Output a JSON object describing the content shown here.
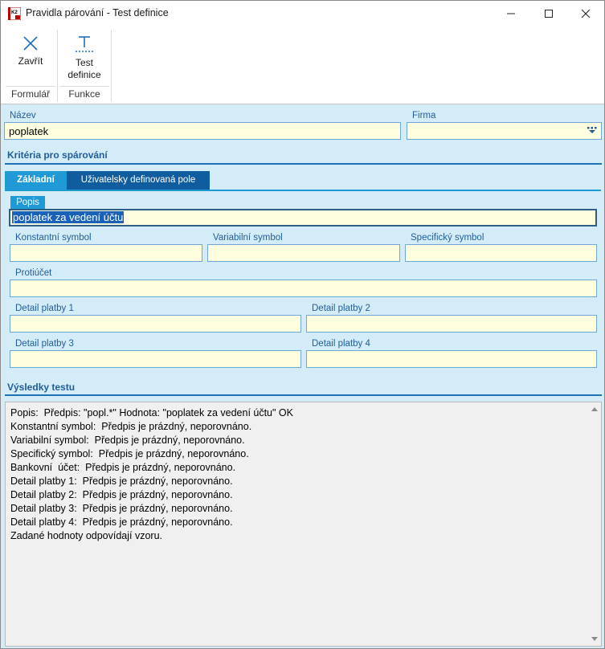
{
  "window": {
    "title": "Pravidla párování - Test definice",
    "app_icon_label": "K2"
  },
  "ribbon": {
    "close_label": "Zavřít",
    "test_label_line1": "Test",
    "test_label_line2": "definice",
    "group_formular": "Formulář",
    "group_funkce": "Funkce"
  },
  "form": {
    "nazev_label": "Název",
    "nazev_value": "poplatek",
    "firma_label": "Firma",
    "firma_value": ""
  },
  "criteria": {
    "title": "Kritéria pro spárování",
    "tabs": [
      "Základní",
      "Uživatelsky definovaná pole"
    ],
    "active_tab": 0,
    "popis_label": "Popis",
    "popis_value": "poplatek za vedení účtu",
    "konst_label": "Konstantní symbol",
    "var_label": "Variabilní symbol",
    "spec_label": "Specifický symbol",
    "protiucet_label": "Protiúčet",
    "detail1_label": "Detail platby 1",
    "detail2_label": "Detail platby 2",
    "detail3_label": "Detail platby 3",
    "detail4_label": "Detail platby 4"
  },
  "results": {
    "title": "Výsledky testu",
    "lines": [
      "Popis:  Předpis: \"popl.*\" Hodnota: \"poplatek za vedení účtu\" OK",
      "Konstantní symbol:  Předpis je prázdný, neporovnáno.",
      "Variabilní symbol:  Předpis je prázdný, neporovnáno.",
      "Specifický symbol:  Předpis je prázdný, neporovnáno.",
      "Bankovní  účet:  Předpis je prázdný, neporovnáno.",
      "Detail platby 1:  Předpis je prázdný, neporovnáno.",
      "Detail platby 2:  Předpis je prázdný, neporovnáno.",
      "Detail platby 3:  Předpis je prázdný, neporovnáno.",
      "Detail platby 4:  Předpis je prázdný, neporovnáno.",
      "Zadané hodnoty odpovídají vzoru."
    ]
  },
  "colors": {
    "accent": "#1f9ad6",
    "tab_inactive": "#0f5c9e",
    "field_bg": "#ffffe0",
    "label": "#1f5c99"
  }
}
